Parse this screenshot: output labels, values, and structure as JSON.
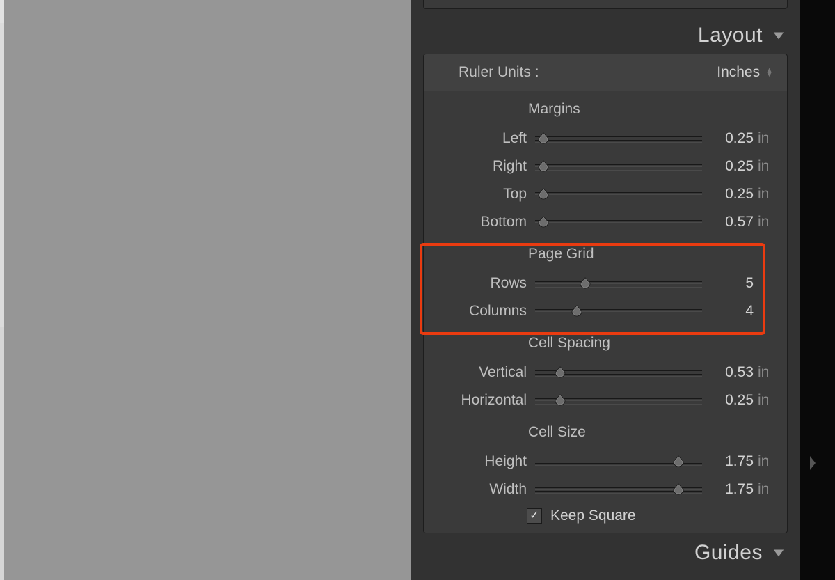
{
  "sections": {
    "layout_title": "Layout",
    "guides_title": "Guides"
  },
  "ruler": {
    "label": "Ruler Units :",
    "value": "Inches"
  },
  "margins": {
    "title": "Margins",
    "left": {
      "label": "Left",
      "value": "0.25",
      "unit": "in",
      "percent": 5
    },
    "right": {
      "label": "Right",
      "value": "0.25",
      "unit": "in",
      "percent": 5
    },
    "top": {
      "label": "Top",
      "value": "0.25",
      "unit": "in",
      "percent": 5
    },
    "bottom": {
      "label": "Bottom",
      "value": "0.57",
      "unit": "in",
      "percent": 5
    }
  },
  "page_grid": {
    "title": "Page Grid",
    "rows": {
      "label": "Rows",
      "value": "5",
      "percent": 30
    },
    "columns": {
      "label": "Columns",
      "value": "4",
      "percent": 25
    }
  },
  "cell_spacing": {
    "title": "Cell Spacing",
    "vertical": {
      "label": "Vertical",
      "value": "0.53",
      "unit": "in",
      "percent": 15
    },
    "horizontal": {
      "label": "Horizontal",
      "value": "0.25",
      "unit": "in",
      "percent": 15
    }
  },
  "cell_size": {
    "title": "Cell Size",
    "height": {
      "label": "Height",
      "value": "1.75",
      "unit": "in",
      "percent": 86
    },
    "width": {
      "label": "Width",
      "value": "1.75",
      "unit": "in",
      "percent": 86
    },
    "keep_square_label": "Keep Square",
    "keep_square_checked": true
  }
}
